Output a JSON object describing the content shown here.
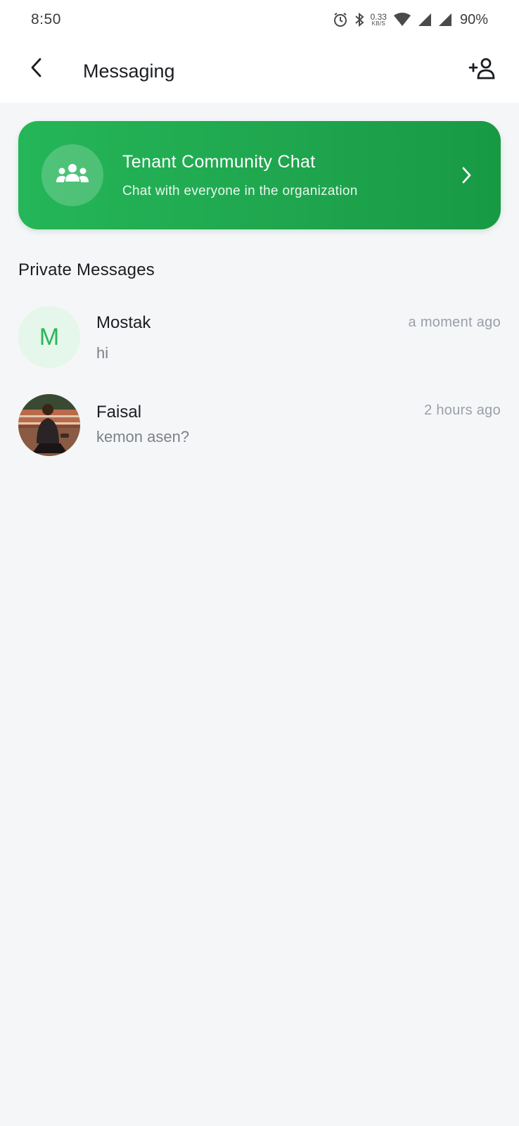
{
  "status_bar": {
    "time": "8:50",
    "net_speed_value": "0.33",
    "net_speed_unit": "KB/S",
    "battery": "90%",
    "icons": [
      "alarm-icon",
      "bluetooth-icon",
      "wifi-icon",
      "signal-icon",
      "signal-icon"
    ]
  },
  "app_bar": {
    "title": "Messaging",
    "back_icon": "chevron-left-icon",
    "action_icon": "add-user-icon"
  },
  "community_card": {
    "title": "Tenant Community Chat",
    "subtitle": "Chat with everyone in the organization",
    "icon": "group-icon",
    "colors": {
      "start": "#25b659",
      "end": "#189a44"
    }
  },
  "private_messages": {
    "heading": "Private Messages",
    "conversations": [
      {
        "name": "Mostak",
        "initial": "M",
        "message": "hi",
        "time": "a moment ago"
      },
      {
        "name": "Faisal",
        "message": "kemon asen?",
        "time": "2 hours ago"
      }
    ]
  },
  "colors": {
    "accent": "#2bb45d",
    "background": "#f5f6f8",
    "muted_text": "#9aa0a8"
  }
}
